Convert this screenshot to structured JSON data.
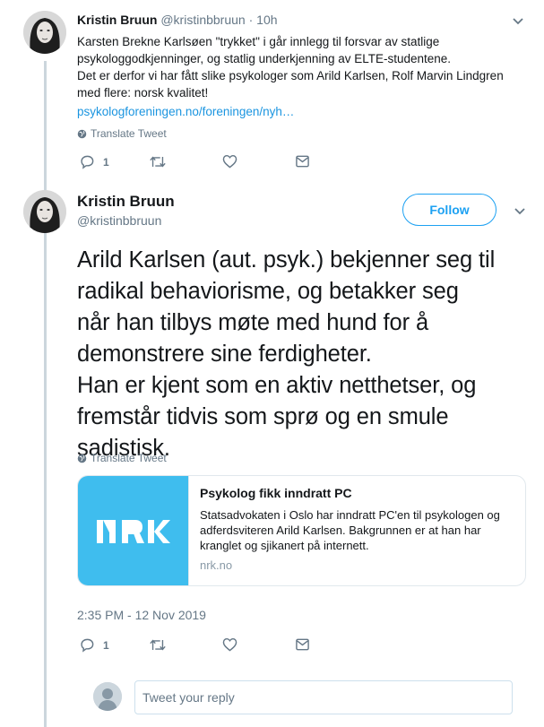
{
  "tweet1": {
    "name": "Kristin Bruun",
    "handle": "@kristinbbruun",
    "separator": "·",
    "time": "10h",
    "lines": [
      "Karsten Brekne Karlsøen \"trykket\" i går innlegg til forsvar av statlige",
      "psykologgodkjenninger, og statlig underkjenning av ELTE-studentene.",
      "Det er derfor vi har fått slike psykologer som Arild Karlsen, Rolf Marvin Lindgren",
      "med flere: norsk kvalitet!"
    ],
    "link": "psykologforeningen.no/foreningen/nyh…",
    "translate": "Translate Tweet",
    "reply_count": "1"
  },
  "tweet2": {
    "name": "Kristin Bruun",
    "handle": "@kristinbbruun",
    "follow_label": "Follow",
    "lines": [
      "Arild Karlsen (aut. psyk.) bekjenner seg til",
      "radikal behaviorisme, og betakker seg",
      "når han tilbys møte med hund for å",
      "demonstrere sine ferdigheter.",
      "Han er kjent som en aktiv netthetser, og",
      "fremstår tidvis som sprø og en smule",
      "sadistisk."
    ],
    "translate": "Translate Tweet",
    "card": {
      "logo_text": "NRK",
      "title": "Psykolog fikk inndratt PC",
      "description": "Statsadvokaten i Oslo har inndratt PC'en til psykologen og adferdsviteren Arild Karlsen. Bakgrunnen er at han har kranglet og sjikanert på internett.",
      "domain": "nrk.no",
      "brand_color": "#3fbdee"
    },
    "timestamp": "2:35 PM - 12 Nov 2019",
    "reply_count": "1"
  },
  "reply_box": {
    "placeholder": "Tweet your reply"
  },
  "colors": {
    "accent": "#1da1f2",
    "link": "#1b95e0",
    "muted": "#657786",
    "thread_line": "#ccd6dd"
  },
  "icons": [
    "globe-icon",
    "reply-icon",
    "retweet-icon",
    "like-icon",
    "message-icon",
    "chevron-down-icon"
  ]
}
